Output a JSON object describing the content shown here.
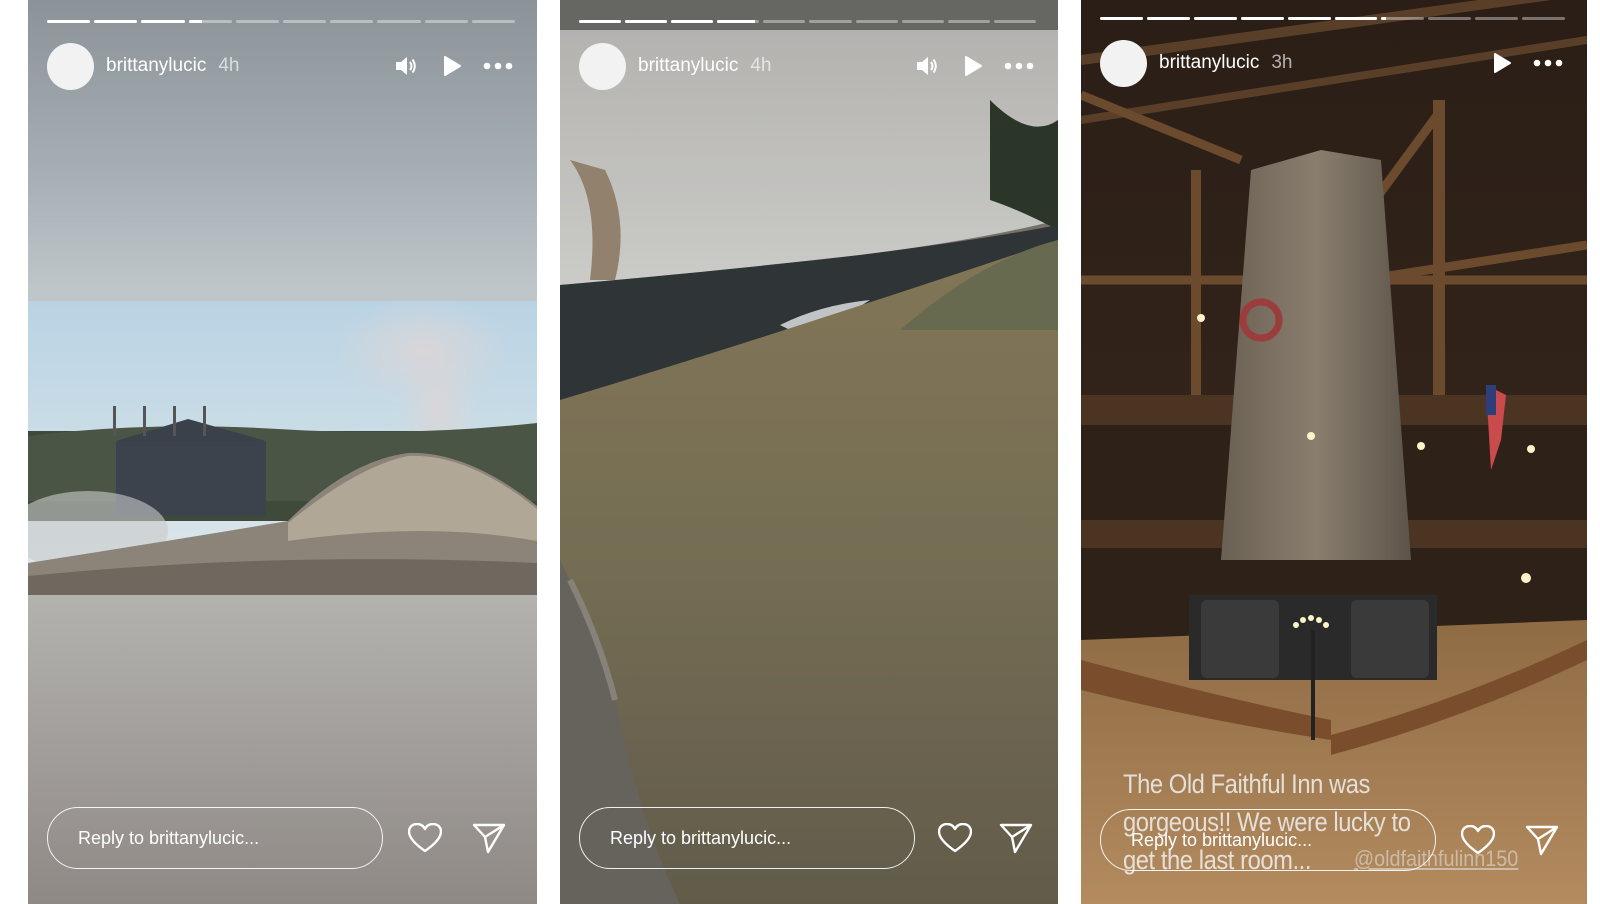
{
  "stories": [
    {
      "username": "brittanylucic",
      "time": "4h",
      "progress_segments": 10,
      "progress_current": 4,
      "progress_fraction": 0.3,
      "has_sound": true,
      "reply_placeholder": "Reply to brittanylucic..."
    },
    {
      "username": "brittanylucic",
      "time": "4h",
      "progress_segments": 10,
      "progress_current": 4,
      "progress_fraction": 0.9,
      "has_sound": true,
      "reply_placeholder": "Reply to brittanylucic..."
    },
    {
      "username": "brittanylucic",
      "time": "3h",
      "progress_segments": 10,
      "progress_current": 7,
      "progress_fraction": 0.1,
      "has_sound": false,
      "reply_placeholder": "Reply to brittanylucic...",
      "caption": "The Old Faithful Inn was gorgeous!! We were lucky to get the last room...",
      "mention": "@oldfaithfulinn150"
    }
  ],
  "icons": {
    "sound": "speaker-icon",
    "play": "play-icon",
    "more": "more-icon",
    "like": "heart-icon",
    "share": "send-icon"
  }
}
